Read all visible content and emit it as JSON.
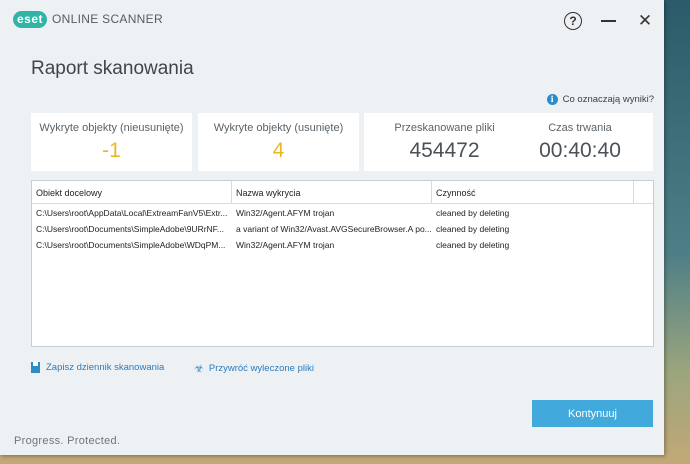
{
  "app": {
    "logo_badge": "eset",
    "logo_text": "ONLINE SCANNER",
    "title": "Raport skanowania",
    "help_glyph": "?",
    "close_glyph": "✕"
  },
  "info_link": {
    "icon": "i",
    "label": "Co oznaczają wyniki?"
  },
  "stats": [
    {
      "label": "Wykryte objekty (nieusunięte)",
      "value": "-1",
      "color": "#e8b922"
    },
    {
      "label": "Wykryte objekty (usunięte)",
      "value": "4",
      "color": "#e8b922"
    },
    {
      "label": "Przeskanowane pliki",
      "value": "454472",
      "color": "#4a5258"
    },
    {
      "label": "Czas trwania",
      "value": "00:40:40",
      "color": "#4a5258"
    }
  ],
  "table": {
    "columns": [
      "Obiekt docelowy",
      "Nazwa wykrycia",
      "Czynność"
    ],
    "rows": [
      [
        "C:\\Users\\root\\AppData\\Local\\ExtreamFanV5\\Extr...",
        "Win32/Agent.AFYM trojan",
        "cleaned by deleting"
      ],
      [
        "C:\\Users\\root\\Documents\\SimpleAdobe\\9URrNF...",
        "a variant of Win32/Avast.AVGSecureBrowser.A po...",
        "cleaned by deleting"
      ],
      [
        "C:\\Users\\root\\Documents\\SimpleAdobe\\WDqPM...",
        "Win32/Agent.AFYM trojan",
        "cleaned by deleting"
      ]
    ]
  },
  "links": {
    "save_log": "Zapisz dziennik skanowania",
    "restore": "Przywróć wyleczone pliki"
  },
  "continue_label": "Kontynuuj",
  "tagline": "Progress. Protected.",
  "colors": {
    "accent": "#41a9dc",
    "brand": "#31b3a6",
    "warning": "#e8b922"
  }
}
